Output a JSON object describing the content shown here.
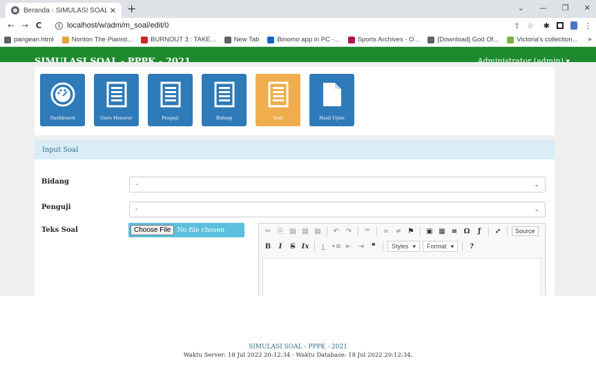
{
  "browser": {
    "tab_title": "Beranda - SIMULASI SOAL - PPPK",
    "tab_close": "✕",
    "new_tab": "+",
    "url": "localhost/w/adm/m_soal/edit/0",
    "bookmarks": [
      {
        "label": "pangean.html",
        "color": "#5f6368"
      },
      {
        "label": "Nonton The Pianist...",
        "color": "#e8a33d"
      },
      {
        "label": "BURNOUT 3 : TAKE...",
        "color": "#c62828"
      },
      {
        "label": "New Tab",
        "color": "#5f6368"
      },
      {
        "label": "Binomo app in PC -...",
        "color": "#1565c0"
      },
      {
        "label": "Sports Archives - O...",
        "color": "#ad1457"
      },
      {
        "label": "[Download] God Of...",
        "color": "#5f6368"
      },
      {
        "label": "Victoria's collection...",
        "color": "#7cb342"
      }
    ]
  },
  "app": {
    "brand": "SIMULASI SOAL - PPPK - 2021",
    "user_menu": "Administrator (admin) ▾",
    "accent": "#1e8a2e"
  },
  "menu": [
    {
      "label": "Dashboard",
      "icon": "gauge-icon",
      "active": false
    },
    {
      "label": "Guru Honorer",
      "icon": "list-icon",
      "active": false
    },
    {
      "label": "Penguji",
      "icon": "list-icon",
      "active": false
    },
    {
      "label": "Bidang",
      "icon": "list-icon",
      "active": false
    },
    {
      "label": "Soal",
      "icon": "list-icon",
      "active": true
    },
    {
      "label": "Hasil Ujian",
      "icon": "document-icon",
      "active": false
    }
  ],
  "form": {
    "heading": "Input Soal",
    "bidang_label": "Bidang",
    "bidang_value": "-",
    "penguji_label": "Penguji",
    "penguji_value": "-",
    "teks_soal_label": "Teks Soal",
    "file_button": "Choose File",
    "file_status": "No file chosen",
    "editor": {
      "source_label": "Source",
      "styles_label": "Styles",
      "format_label": "Format",
      "help_label": "?"
    }
  },
  "footer": {
    "title": "SIMULASI SOAL - PPPK - 2021",
    "info": "Waktu Server: 18 Jul 2022 20:12:34 - Waktu Database: 18 Jul 2022 20:12:34."
  }
}
